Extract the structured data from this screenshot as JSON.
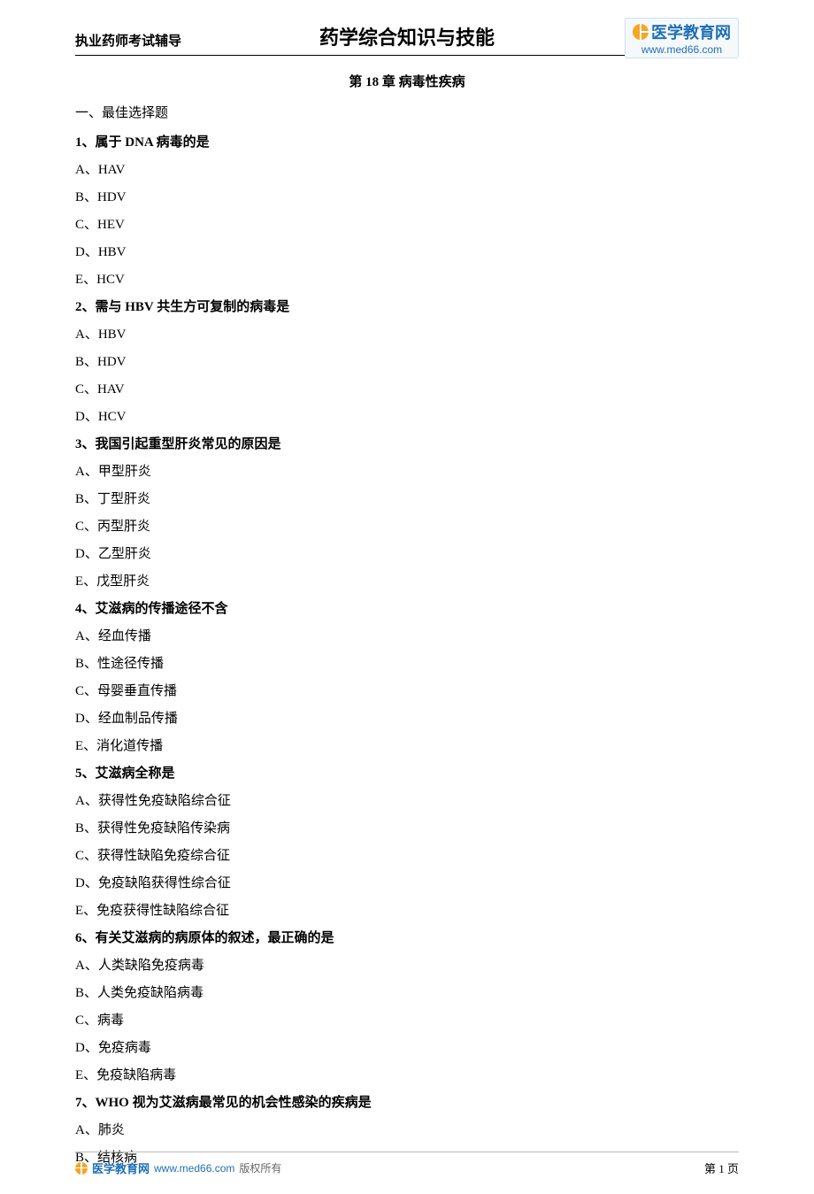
{
  "header": {
    "left": "执业药师考试辅导",
    "center": "药学综合知识与技能",
    "logo_text": "医学教育网",
    "logo_url": "www.med66.com"
  },
  "chapter_title": "第 18 章 病毒性疾病",
  "section_title": "一、最佳选择题",
  "questions": [
    {
      "q": "1、属于 DNA 病毒的是",
      "options": [
        "A、HAV",
        "B、HDV",
        "C、HEV",
        "D、HBV",
        "E、HCV"
      ]
    },
    {
      "q": "2、需与 HBV 共生方可复制的病毒是",
      "options": [
        "A、HBV",
        "B、HDV",
        "C、HAV",
        "D、HCV"
      ]
    },
    {
      "q": "3、我国引起重型肝炎常见的原因是",
      "options": [
        "A、甲型肝炎",
        "B、丁型肝炎",
        "C、丙型肝炎",
        "D、乙型肝炎",
        "E、戊型肝炎"
      ]
    },
    {
      "q": "4、艾滋病的传播途径不含",
      "options": [
        "A、经血传播",
        "B、性途径传播",
        "C、母婴垂直传播",
        "D、经血制品传播",
        "E、消化道传播"
      ]
    },
    {
      "q": "5、艾滋病全称是",
      "options": [
        "A、获得性免疫缺陷综合征",
        "B、获得性免疫缺陷传染病",
        "C、获得性缺陷免疫综合征",
        "D、免疫缺陷获得性综合征",
        "E、免疫获得性缺陷综合征"
      ]
    },
    {
      "q": "6、有关艾滋病的病原体的叙述，最正确的是",
      "options": [
        "A、人类缺陷免疫病毒",
        "B、人类免疫缺陷病毒",
        "C、病毒",
        "D、免疫病毒",
        "E、免疫缺陷病毒"
      ]
    },
    {
      "q": "7、WHO 视为艾滋病最常见的机会性感染的疾病是",
      "options": [
        "A、肺炎",
        "B、结核病"
      ]
    }
  ],
  "footer": {
    "brand": "医学教育网",
    "url": "www.med66.com",
    "copyright": "版权所有",
    "page": "第 1 页"
  }
}
